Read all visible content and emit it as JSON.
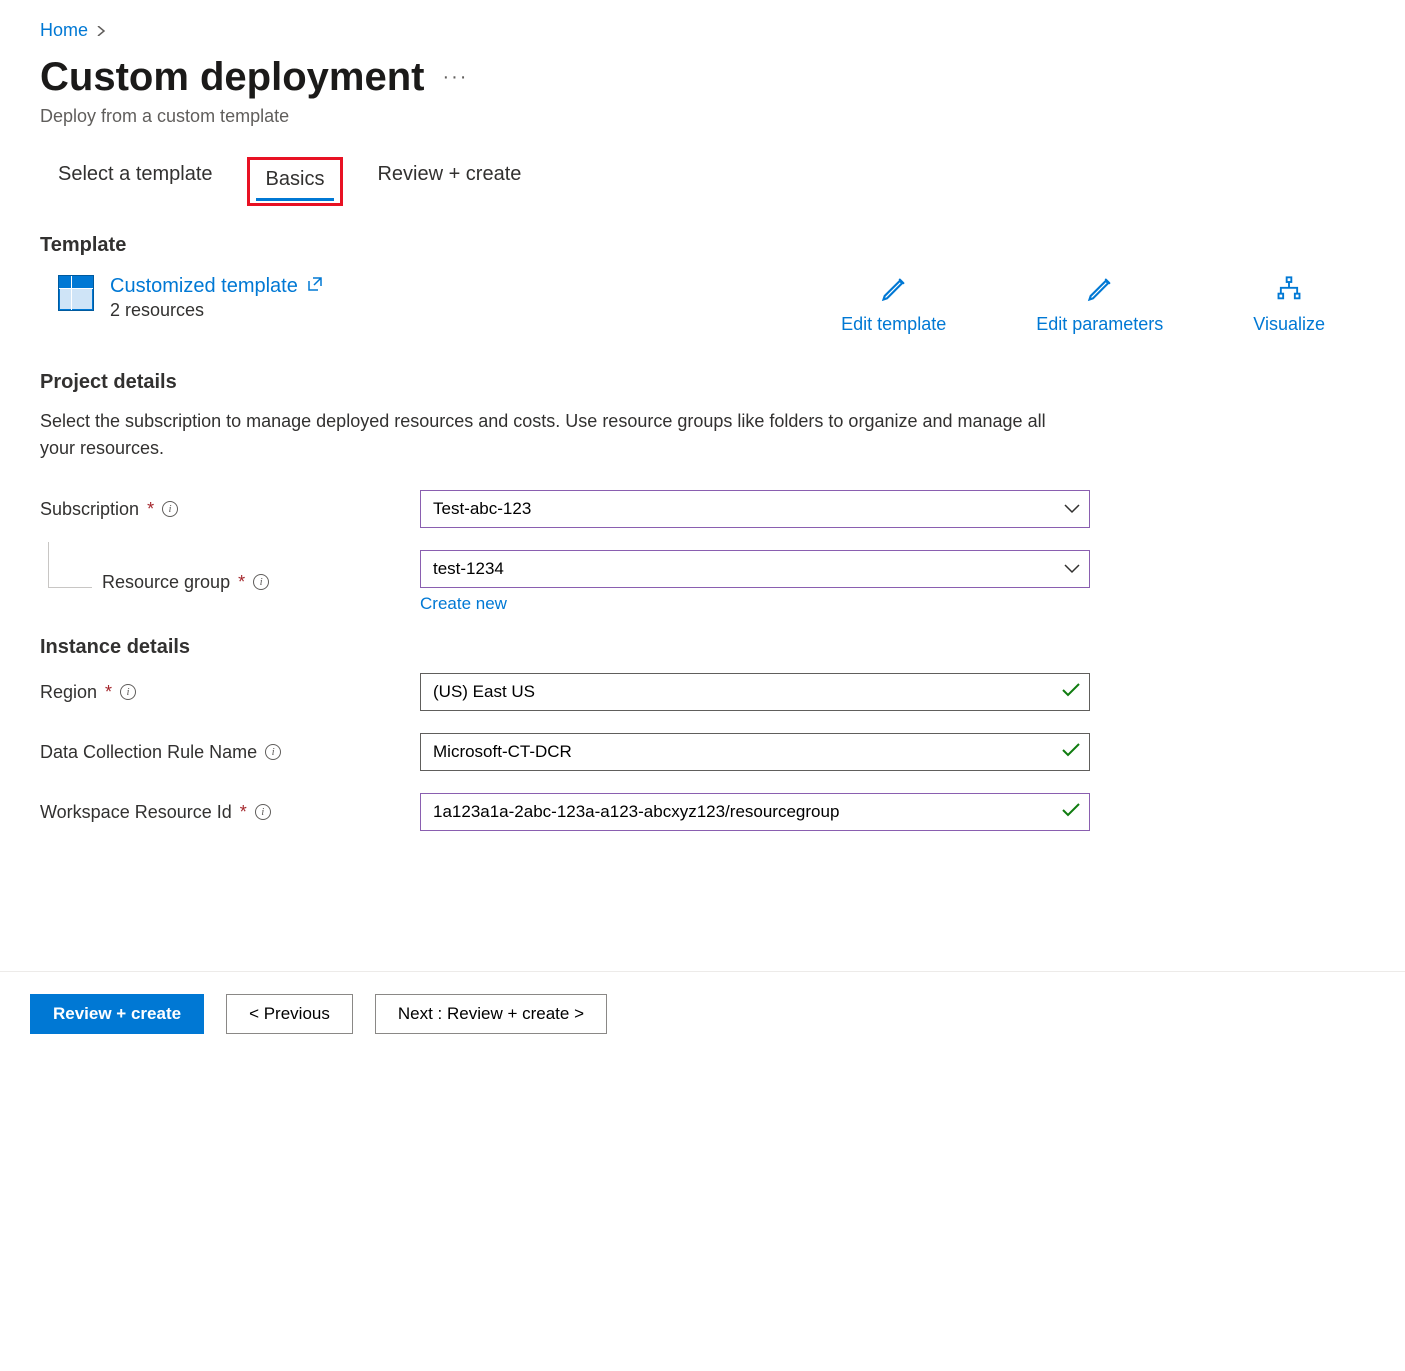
{
  "breadcrumb": {
    "home": "Home"
  },
  "header": {
    "title": "Custom deployment",
    "subtitle": "Deploy from a custom template"
  },
  "tabs": {
    "select_template": "Select a template",
    "basics": "Basics",
    "review_create": "Review + create"
  },
  "template": {
    "section_label": "Template",
    "link_text": "Customized template",
    "resource_count": "2 resources",
    "edit_template": "Edit template",
    "edit_parameters": "Edit parameters",
    "visualize": "Visualize"
  },
  "project_details": {
    "title": "Project details",
    "description": "Select the subscription to manage deployed resources and costs. Use resource groups like folders to organize and manage all your resources.",
    "subscription_label": "Subscription",
    "subscription_value": "Test-abc-123",
    "resource_group_label": "Resource group",
    "resource_group_value": "test-1234",
    "create_new": "Create new"
  },
  "instance_details": {
    "title": "Instance details",
    "region_label": "Region",
    "region_value": "(US) East US",
    "dcr_label": "Data Collection Rule Name",
    "dcr_value": "Microsoft-CT-DCR",
    "workspace_label": "Workspace Resource Id",
    "workspace_value": "1a123a1a-2abc-123a-a123-abcxyz123/resourcegroup"
  },
  "footer": {
    "review_create": "Review + create",
    "previous": "< Previous",
    "next": "Next : Review + create >"
  }
}
